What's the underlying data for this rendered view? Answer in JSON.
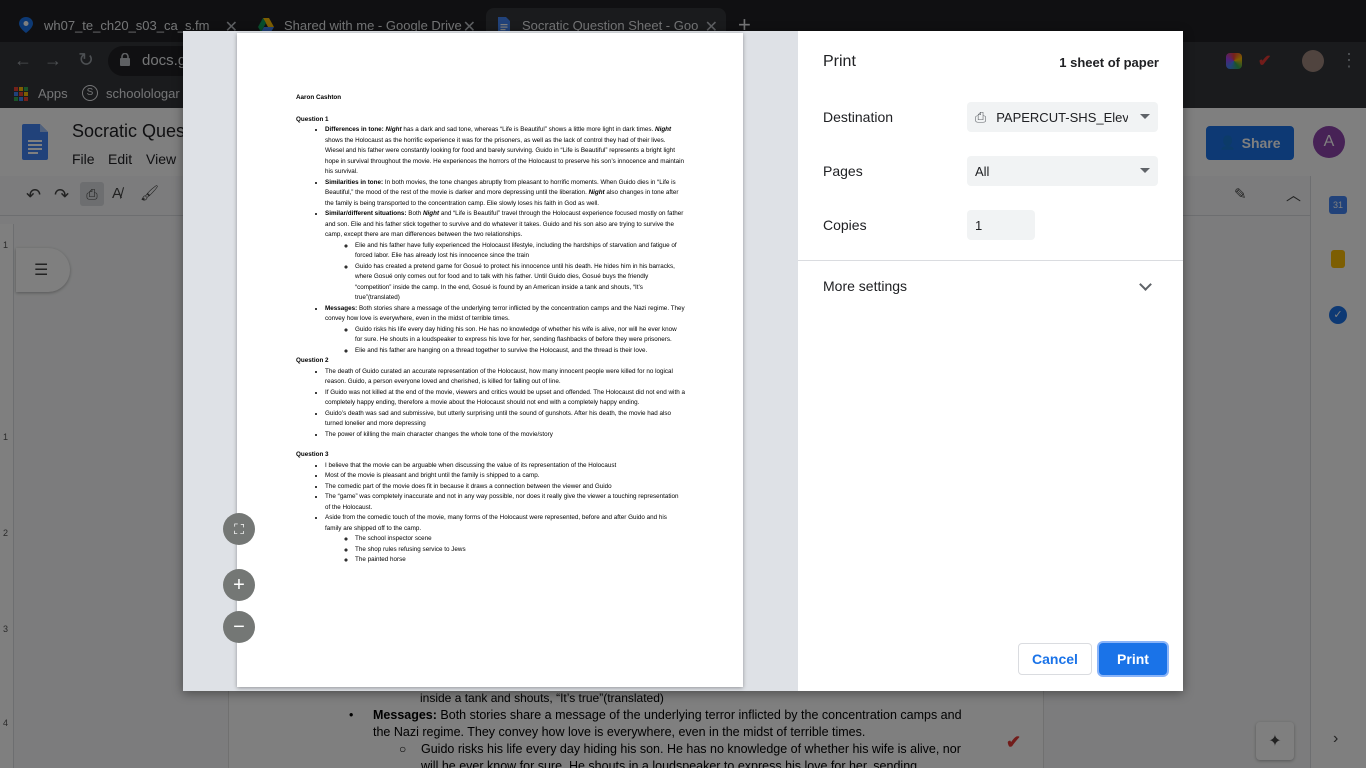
{
  "browser": {
    "tabs": [
      {
        "title": "wh07_te_ch20_s03_ca_s.fm"
      },
      {
        "title": "Shared with me - Google Drive"
      },
      {
        "title": "Socratic Question Sheet - Goo"
      }
    ],
    "new_tab": "+",
    "close": "✕",
    "url": "docs.g",
    "bookmarks": [
      {
        "label": "Apps"
      },
      {
        "label": "schoolologar"
      }
    ]
  },
  "docs": {
    "title": "Socratic Ques",
    "menu": [
      "File",
      "Edit",
      "View"
    ],
    "share_label": "Share",
    "avatar_initial": "A",
    "ruler_numbers": [
      "1",
      "1",
      "2",
      "3",
      "4"
    ],
    "background_lines": [
      "inside a tank and shouts, “It’s true”(translated)",
      "Messages:",
      "Both stories share a message of the underlying terror inflicted by the concentration camps and",
      "the Nazi regime. They convey how love is everywhere, even in the midst of terrible times.",
      "Guido risks his life every day hiding his son. He has no knowledge of whether his wife is alive, nor",
      "will he ever know for sure. He shouts in a loudspeaker to express his love for her, sending"
    ]
  },
  "print_dialog": {
    "title": "Print",
    "sheets": "1 sheet of paper",
    "destination_label": "Destination",
    "destination_value": "PAPERCUT-SHS_Eleva",
    "pages_label": "Pages",
    "pages_value": "All",
    "copies_label": "Copies",
    "copies_value": "1",
    "more_settings": "More settings",
    "cancel": "Cancel",
    "print": "Print"
  },
  "document": {
    "author": "Aaron Cashton",
    "q1": {
      "heading": "Question 1",
      "b1_label": "Differences in tone:",
      "b1_night": "Night",
      "b1_text": " has a dark and sad tone, whereas “Life is Beautiful” shows a little more light in dark times. ",
      "b1_night2": "Night",
      "b1_text2": " shows the Holocaust as the horrific experience it was for the prisoners, as well as the lack of control they had of their lives. Wiesel and his father were constantly looking for food and barely surviving. Guido in “Life is Beautiful” represents a bright light hope in survival throughout the movie. He experiences the horrors of the Holocaust to preserve his son’s innocence and maintain his survival.",
      "b2_label": "Similarities in tone:",
      "b2_text": " In both movies, the tone changes abruptly from pleasant to horrific moments. When Guido dies in “Life is Beautiful,” the mood of the rest of the movie is darker and more depressing until the liberation. ",
      "b2_night": "Night",
      "b2_text2": " also changes in tone after the family is being transported to the concentration camp. Elie slowly loses his faith in God as well.",
      "b3_label": "Similar/different situations:",
      "b3_text": " Both ",
      "b3_night": "Night",
      "b3_text2": " and “Life is Beautiful” travel through the Holocaust experience focused mostly on father and son. Elie and his father stick together to survive and do whatever it takes. Guido and his son also are trying to survive the camp, except there are man differences between the two relationships.",
      "b3_sub1": "Elie and his father have fully experienced the Holocaust lifestyle, including the hardships of starvation and fatigue of forced labor. Elie has already lost his innocence since the train",
      "b3_sub2": "Guido has created a pretend game for Gosué to protect his innocence until his death. He hides him in his barracks, where Gosué only comes out for food and to talk with his father. Until Guido dies, Gosué buys the friendly “competition” inside the camp. In the end, Gosué is found by an American inside a tank and shouts, “It’s true”(translated)",
      "b4_label": "Messages:",
      "b4_text": " Both stories share a message of the underlying terror inflicted by the concentration camps and the Nazi regime. They convey how love is everywhere, even in the midst of terrible times.",
      "b4_sub1": "Guido risks his life every day hiding his son. He has no knowledge of whether his wife is alive, nor will he ever know for sure. He shouts in a loudspeaker to express his love for her, sending flashbacks of before they were prisoners.",
      "b4_sub2": "Elie and his father are hanging on a thread together to survive the Holocaust, and the thread is their love."
    },
    "q2": {
      "heading": "Question 2",
      "items": [
        "The death of Guido curated an accurate representation of the Holocaust, how many innocent people were killed for no logical reason. Guido, a person everyone loved and cherished, is killed for falling out of line.",
        "If Guido was not killed at the end of the movie, viewers and critics would be upset and offended. The Holocaust did not end with a completely happy ending, therefore a movie about the Holocaust should not end with a completely happy ending.",
        "Guido’s death was sad and submissive, but utterly surprising until the sound of gunshots. After his death, the movie had also turned lonelier and more depressing",
        "The power of killing the main character changes the whole tone of the movie/story"
      ]
    },
    "q3": {
      "heading": "Question 3",
      "items": [
        "I believe that the movie can be arguable when discussing the value of its representation of the Holocaust",
        "Most of the movie is pleasant and bright until the family is shipped to a camp.",
        "The comedic part of the movie does fit in because it draws a connection between the viewer and Guido",
        "The “game” was completely inaccurate and not in any way possible, nor does it really give the viewer a touching representation of the Holocaust.",
        "Aside from the comedic touch of the movie, many forms of the Holocaust were represented, before and after Guido and his family are shipped off to the camp."
      ],
      "sub": [
        "The school inspector scene",
        "The shop rules refusing service to Jews",
        "The painted horse"
      ]
    }
  },
  "colors": {
    "accent": "#1a73e8",
    "chrome_dark": "#202124",
    "chrome_tab": "#35363a",
    "avatar": "#8e44ad"
  }
}
